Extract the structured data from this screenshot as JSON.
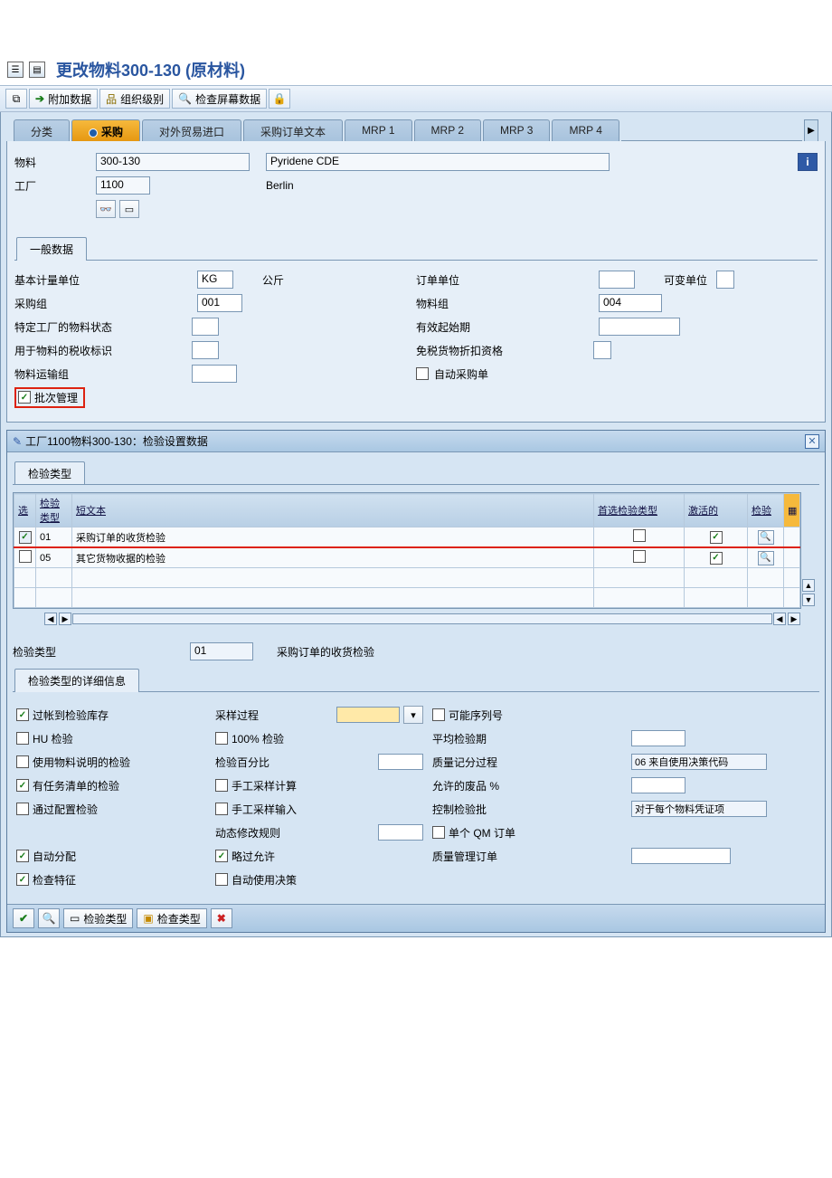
{
  "title": "更改物料300-130 (原材料)",
  "toolbar": {
    "extra_data": "附加数据",
    "org_level": "组织级别",
    "check_screen": "检查屏幕数据"
  },
  "tabs": [
    "分类",
    "采购",
    "对外贸易进口",
    "采购订单文本",
    "MRP 1",
    "MRP 2",
    "MRP 3",
    "MRP 4"
  ],
  "active_tab_index": 1,
  "header": {
    "material_label": "物料",
    "material_value": "300-130",
    "material_desc": "Pyridene CDE",
    "plant_label": "工厂",
    "plant_value": "1100",
    "plant_desc": "Berlin"
  },
  "general_group": {
    "title": "一般数据",
    "base_uom_label": "基本计量单位",
    "base_uom_value": "KG",
    "base_uom_text": "公斤",
    "order_unit_label": "订单单位",
    "var_unit_label": "可变单位",
    "purch_group_label": "采购组",
    "purch_group_value": "001",
    "material_group_label": "物料组",
    "material_group_value": "004",
    "plant_status_label": "特定工厂的物料状态",
    "valid_from_label": "有效起始期",
    "tax_ind_label": "用于物料的税收标识",
    "tax_free_label": "免税货物折扣资格",
    "freight_group_label": "物料运输组",
    "auto_po_label": "自动采购单",
    "batch_mgmt_label": "批次管理"
  },
  "dialog": {
    "title": "工厂1100物料300-130：检验设置数据",
    "types_group_title": "检验类型",
    "table": {
      "headers": {
        "sel": "选",
        "type": "检验类型",
        "short": "短文本",
        "pref": "首选检验类型",
        "active": "激活的",
        "det": "检验"
      },
      "rows": [
        {
          "sel": true,
          "type": "01",
          "short": "采购订单的收货检验",
          "pref": false,
          "active": true
        },
        {
          "sel": false,
          "type": "05",
          "short": "其它货物收据的检验",
          "pref": false,
          "active": true
        }
      ]
    },
    "detail_header": {
      "type_label": "检验类型",
      "type_value": "01",
      "type_text": "采购订单的收货检验"
    },
    "detail_group_title": "检验类型的详细信息",
    "details": {
      "post_insp_stock": {
        "label": "过帐到检验库存",
        "checked": true
      },
      "hu_insp": {
        "label": "HU 检验",
        "checked": false
      },
      "use_mat_spec": {
        "label": "使用物料说明的检验",
        "checked": false
      },
      "task_list_insp": {
        "label": "有任务清单的检验",
        "checked": true
      },
      "config_insp": {
        "label": "通过配置检验",
        "checked": false
      },
      "auto_assign": {
        "label": "自动分配",
        "checked": true
      },
      "check_char": {
        "label": "检查特征",
        "checked": true
      },
      "sampling_proc": {
        "label": "采样过程"
      },
      "hundred_pct": {
        "label": "100% 检验",
        "checked": false
      },
      "insp_pct": {
        "label": "检验百分比"
      },
      "manual_calc": {
        "label": "手工采样计算",
        "checked": false
      },
      "manual_input": {
        "label": "手工采样输入",
        "checked": false
      },
      "dyn_mod_rule": {
        "label": "动态修改规则"
      },
      "skip_allowed": {
        "label": "略过允许",
        "checked": true
      },
      "auto_decision": {
        "label": "自动使用决策",
        "checked": false
      },
      "possible_serial": {
        "label": "可能序列号",
        "checked": false
      },
      "avg_insp_dur": {
        "label": "平均检验期"
      },
      "q_score_proc": {
        "label": "质量记分过程",
        "value": "06 来自使用决策代码"
      },
      "allowed_scrap": {
        "label": "允许的废品 %"
      },
      "control_lot": {
        "label": "控制检验批",
        "value": "对于每个物料凭证项"
      },
      "single_qm_order": {
        "label": "单个 QM 订单",
        "checked": false
      },
      "qm_order": {
        "label": "质量管理订单"
      }
    },
    "buttons": {
      "insp_type": "检验类型",
      "check_type": "检查类型"
    }
  }
}
